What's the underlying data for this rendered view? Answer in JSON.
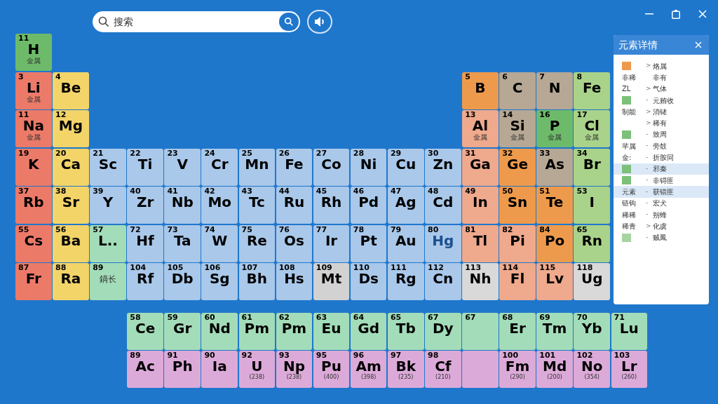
{
  "search": {
    "placeholder": "搜索"
  },
  "table": {
    "rows": [
      [
        {
          "kind": "element",
          "number": "11",
          "symbol": "H",
          "name": "金属",
          "color": "#6dbb6a"
        }
      ],
      [
        {
          "kind": "element",
          "number": "3",
          "symbol": "Li",
          "name": "金属",
          "color": "#ec7a68"
        },
        {
          "kind": "element",
          "number": "4",
          "symbol": "Be",
          "color": "#f3d469"
        },
        {
          "kind": "gap"
        },
        {
          "kind": "gap"
        },
        {
          "kind": "gap"
        },
        {
          "kind": "gap"
        },
        {
          "kind": "gap"
        },
        {
          "kind": "gap"
        },
        {
          "kind": "gap"
        },
        {
          "kind": "gap"
        },
        {
          "kind": "gap"
        },
        {
          "kind": "gap"
        },
        {
          "kind": "element",
          "number": "5",
          "symbol": "B",
          "color": "#ee9a4c"
        },
        {
          "kind": "element",
          "number": "6",
          "symbol": "C",
          "color": "#b6a895"
        },
        {
          "kind": "element",
          "number": "7",
          "symbol": "N",
          "color": "#b6a895"
        },
        {
          "kind": "element",
          "number": "8",
          "symbol": "Fe",
          "color": "#a9d38a"
        }
      ],
      [
        {
          "kind": "element",
          "number": "11",
          "symbol": "Na",
          "name": "金属",
          "color": "#ec7a68"
        },
        {
          "kind": "element",
          "number": "12",
          "symbol": "Mg",
          "color": "#f3d469"
        },
        {
          "kind": "gap"
        },
        {
          "kind": "gap"
        },
        {
          "kind": "gap"
        },
        {
          "kind": "gap"
        },
        {
          "kind": "gap"
        },
        {
          "kind": "gap"
        },
        {
          "kind": "gap"
        },
        {
          "kind": "gap"
        },
        {
          "kind": "gap"
        },
        {
          "kind": "gap"
        },
        {
          "kind": "element",
          "number": "13",
          "symbol": "Al",
          "name": "金属",
          "color": "#efa98c"
        },
        {
          "kind": "element",
          "number": "14",
          "symbol": "Si",
          "name": "金属",
          "color": "#b6a895"
        },
        {
          "kind": "element",
          "number": "16",
          "symbol": "P",
          "name": "金属",
          "color": "#6dbb6a"
        },
        {
          "kind": "element",
          "number": "17",
          "symbol": "Cl",
          "name": "金属",
          "color": "#a9d38a"
        }
      ],
      [
        {
          "kind": "element",
          "number": "19",
          "symbol": "K",
          "color": "#ec7a68"
        },
        {
          "kind": "element",
          "number": "20",
          "symbol": "Ca",
          "color": "#f3d469"
        },
        {
          "kind": "element",
          "number": "21",
          "symbol": "Sc",
          "color": "#a9c8ea"
        },
        {
          "kind": "element",
          "number": "22",
          "symbol": "Ti",
          "color": "#a9c8ea"
        },
        {
          "kind": "element",
          "number": "23",
          "symbol": "V",
          "color": "#a9c8ea"
        },
        {
          "kind": "element",
          "number": "24",
          "symbol": "Cr",
          "color": "#a9c8ea"
        },
        {
          "kind": "element",
          "number": "25",
          "symbol": "Mn",
          "color": "#a9c8ea"
        },
        {
          "kind": "element",
          "number": "26",
          "symbol": "Fe",
          "color": "#a9c8ea"
        },
        {
          "kind": "element",
          "number": "27",
          "symbol": "Co",
          "color": "#a9c8ea"
        },
        {
          "kind": "element",
          "number": "28",
          "symbol": "Ni",
          "color": "#a9c8ea"
        },
        {
          "kind": "element",
          "number": "29",
          "symbol": "Cu",
          "color": "#a9c8ea"
        },
        {
          "kind": "element",
          "number": "30",
          "symbol": "Zn",
          "color": "#a9c8ea"
        },
        {
          "kind": "element",
          "number": "31",
          "symbol": "Ga",
          "color": "#efa98c"
        },
        {
          "kind": "element",
          "number": "32",
          "symbol": "Ge",
          "color": "#ee9a4c"
        },
        {
          "kind": "element",
          "number": "33",
          "symbol": "As",
          "color": "#b6a895"
        },
        {
          "kind": "element",
          "number": "34",
          "symbol": "Br",
          "color": "#a9d38a"
        }
      ],
      [
        {
          "kind": "element",
          "number": "37",
          "symbol": "Rb",
          "color": "#ec7a68"
        },
        {
          "kind": "element",
          "number": "38",
          "symbol": "Sr",
          "color": "#f3d469"
        },
        {
          "kind": "element",
          "number": "39",
          "symbol": "Y",
          "color": "#a9c8ea"
        },
        {
          "kind": "element",
          "number": "40",
          "symbol": "Zr",
          "color": "#a9c8ea"
        },
        {
          "kind": "element",
          "number": "41",
          "symbol": "Nb",
          "color": "#a9c8ea"
        },
        {
          "kind": "element",
          "number": "42",
          "symbol": "Mo",
          "color": "#a9c8ea"
        },
        {
          "kind": "element",
          "number": "43",
          "symbol": "Tc",
          "color": "#a9c8ea"
        },
        {
          "kind": "element",
          "number": "44",
          "symbol": "Ru",
          "color": "#a9c8ea"
        },
        {
          "kind": "element",
          "number": "45",
          "symbol": "Rh",
          "color": "#a9c8ea"
        },
        {
          "kind": "element",
          "number": "46",
          "symbol": "Pd",
          "color": "#a9c8ea"
        },
        {
          "kind": "element",
          "number": "47",
          "symbol": "Ag",
          "color": "#a9c8ea"
        },
        {
          "kind": "element",
          "number": "48",
          "symbol": "Cd",
          "color": "#a9c8ea"
        },
        {
          "kind": "element",
          "number": "49",
          "symbol": "In",
          "color": "#efa98c"
        },
        {
          "kind": "element",
          "number": "50",
          "symbol": "Sn",
          "color": "#ee9a4c"
        },
        {
          "kind": "element",
          "number": "51",
          "symbol": "Te",
          "color": "#ee9a4c"
        },
        {
          "kind": "element",
          "number": "53",
          "symbol": "I",
          "color": "#a9d38a"
        }
      ],
      [
        {
          "kind": "element",
          "number": "55",
          "symbol": "Cs",
          "color": "#ec7a68"
        },
        {
          "kind": "element",
          "number": "56",
          "symbol": "Ba",
          "color": "#f3d469"
        },
        {
          "kind": "element",
          "number": "57",
          "symbol": "L..",
          "color": "#a3dcb9"
        },
        {
          "kind": "element",
          "number": "72",
          "symbol": "Hf",
          "color": "#a9c8ea"
        },
        {
          "kind": "element",
          "number": "73",
          "symbol": "Ta",
          "color": "#a9c8ea"
        },
        {
          "kind": "element",
          "number": "74",
          "symbol": "W",
          "color": "#a9c8ea"
        },
        {
          "kind": "element",
          "number": "75",
          "symbol": "Re",
          "color": "#a9c8ea"
        },
        {
          "kind": "element",
          "number": "76",
          "symbol": "Os",
          "color": "#a9c8ea"
        },
        {
          "kind": "element",
          "number": "77",
          "symbol": "Ir",
          "color": "#a9c8ea"
        },
        {
          "kind": "element",
          "number": "78",
          "symbol": "Pt",
          "color": "#a9c8ea"
        },
        {
          "kind": "element",
          "number": "79",
          "symbol": "Au",
          "color": "#a9c8ea"
        },
        {
          "kind": "element",
          "number": "80",
          "symbol": "Hg",
          "color": "#a9c8ea",
          "selected": true
        },
        {
          "kind": "element",
          "number": "81",
          "symbol": "Tl",
          "color": "#efa98c"
        },
        {
          "kind": "element",
          "number": "82",
          "symbol": "Pi",
          "color": "#efa98c"
        },
        {
          "kind": "element",
          "number": "84",
          "symbol": "Po",
          "color": "#ee9a4c"
        },
        {
          "kind": "element",
          "number": "65",
          "symbol": "Rn",
          "color": "#a9d38a"
        }
      ],
      [
        {
          "kind": "element",
          "number": "87",
          "symbol": "Fr",
          "color": "#ec7a68"
        },
        {
          "kind": "element",
          "number": "88",
          "symbol": "Ra",
          "color": "#f3d469"
        },
        {
          "kind": "element",
          "number": "89",
          "name": "鏑长",
          "color": "#a3dcb9"
        },
        {
          "kind": "element",
          "number": "104",
          "symbol": "Rf",
          "color": "#a9c8ea"
        },
        {
          "kind": "element",
          "number": "105",
          "symbol": "Db",
          "color": "#a9c8ea"
        },
        {
          "kind": "element",
          "number": "106",
          "symbol": "Sg",
          "color": "#a9c8ea"
        },
        {
          "kind": "element",
          "number": "107",
          "symbol": "Bh",
          "color": "#a9c8ea"
        },
        {
          "kind": "element",
          "number": "108",
          "symbol": "Hs",
          "color": "#a9c8ea"
        },
        {
          "kind": "element",
          "number": "109",
          "symbol": "Mt",
          "color": "#d2d2d2"
        },
        {
          "kind": "element",
          "number": "110",
          "symbol": "Ds",
          "color": "#a9c8ea"
        },
        {
          "kind": "element",
          "number": "111",
          "symbol": "Rg",
          "color": "#a9c8ea"
        },
        {
          "kind": "element",
          "number": "112",
          "symbol": "Cn",
          "color": "#a9c8ea"
        },
        {
          "kind": "element",
          "number": "113",
          "symbol": "Nh",
          "color": "#d9d9d9"
        },
        {
          "kind": "element",
          "number": "114",
          "symbol": "Fl",
          "color": "#efa98c"
        },
        {
          "kind": "element",
          "number": "115",
          "symbol": "Lv",
          "color": "#efa98c"
        },
        {
          "kind": "element",
          "number": "118",
          "symbol": "Ug",
          "color": "#d9d9d9"
        }
      ]
    ]
  },
  "f_block": {
    "rows": [
      [
        {
          "number": "58",
          "symbol": "Ce",
          "color": "#a3dcb9"
        },
        {
          "number": "59",
          "symbol": "Gr",
          "color": "#a3dcb9"
        },
        {
          "number": "60",
          "symbol": "Nd",
          "color": "#a3dcb9"
        },
        {
          "number": "61",
          "symbol": "Pm",
          "color": "#a3dcb9"
        },
        {
          "number": "62",
          "symbol": "Pm",
          "color": "#a3dcb9"
        },
        {
          "number": "63",
          "symbol": "Eu",
          "color": "#a3dcb9"
        },
        {
          "number": "64",
          "symbol": "Gd",
          "color": "#a3dcb9"
        },
        {
          "number": "65",
          "symbol": "Tb",
          "color": "#a3dcb9"
        },
        {
          "number": "67",
          "symbol": "Dy",
          "color": "#a3dcb9"
        },
        {
          "number": "67",
          "color": "#a3dcb9"
        },
        {
          "number": "68",
          "symbol": "Er",
          "color": "#a3dcb9"
        },
        {
          "number": "69",
          "symbol": "Tm",
          "color": "#a3dcb9"
        },
        {
          "number": "70",
          "symbol": "Yb",
          "color": "#a3dcb9"
        },
        {
          "number": "71",
          "symbol": "Lu",
          "color": "#a3dcb9"
        }
      ],
      [
        {
          "number": "89",
          "symbol": "Ac",
          "color": "#dcaad8"
        },
        {
          "number": "91",
          "symbol": "Ph",
          "color": "#dcaad8"
        },
        {
          "number": "90",
          "symbol": "Ia",
          "color": "#dcaad8"
        },
        {
          "number": "92",
          "symbol": "U",
          "mass": "(238)",
          "color": "#dcaad8"
        },
        {
          "number": "93",
          "symbol": "Np",
          "mass": "(238)",
          "color": "#dcaad8"
        },
        {
          "number": "95",
          "symbol": "Pu",
          "mass": "(400)",
          "color": "#dcaad8"
        },
        {
          "number": "96",
          "symbol": "Am",
          "mass": "(398)",
          "color": "#dcaad8"
        },
        {
          "number": "97",
          "symbol": "Bk",
          "mass": "(235)",
          "color": "#dcaad8"
        },
        {
          "number": "98",
          "symbol": "Cf",
          "mass": "(210)",
          "color": "#dcaad8"
        },
        {
          "color": "#dcaad8"
        },
        {
          "number": "100",
          "symbol": "Fm",
          "mass": "(290)",
          "color": "#dcaad8"
        },
        {
          "number": "101",
          "symbol": "Md",
          "mass": "(200)",
          "color": "#dcaad8"
        },
        {
          "number": "102",
          "symbol": "No",
          "mass": "(354)",
          "color": "#dcaad8"
        },
        {
          "number": "103",
          "symbol": "Lr",
          "mass": "(260)",
          "color": "#dcaad8"
        }
      ]
    ]
  },
  "panel": {
    "title": "元素详情",
    "items": [
      {
        "color": "#ee9a4c",
        "marker": ">",
        "text": "烙属",
        "selected": false
      },
      {
        "label": "非稀",
        "text": "非有",
        "selected": false
      },
      {
        "label": "ZL",
        "marker": ">",
        "text": "气体",
        "selected": false
      },
      {
        "color": "#7cc07a",
        "marker": "-",
        "text": "元贿收",
        "selected": false
      },
      {
        "label": "制能",
        "marker": ">",
        "text": "消铑",
        "selected": false
      },
      {
        "marker": ">",
        "text": "稀有",
        "selected": false
      },
      {
        "color": "#7cc07a",
        "marker": "-",
        "text": "致周",
        "selected": false
      },
      {
        "label": "芊属",
        "marker": "-",
        "text": "旁鼓",
        "selected": false
      },
      {
        "label": "金:",
        "marker": "-",
        "text": "折胺同",
        "selected": false
      },
      {
        "color": "#7cc07a",
        "marker": "-",
        "text": "邪秦",
        "selected": true
      },
      {
        "color": "#7cc07a",
        "marker": "-",
        "text": "非锝匪",
        "selected": false
      },
      {
        "label": "元素",
        "marker": "-",
        "text": "获错匪",
        "selected": true
      },
      {
        "label": "链钩",
        "marker": "-",
        "text": "宏犬",
        "selected": false
      },
      {
        "label": "稀稀",
        "marker": "-",
        "text": "朔蜂",
        "selected": false
      },
      {
        "label": "稀青",
        "marker": ">",
        "text": "化虞",
        "selected": false
      },
      {
        "color": "#a6d4a0",
        "marker": "-",
        "text": "贼鳳",
        "selected": false
      }
    ]
  }
}
